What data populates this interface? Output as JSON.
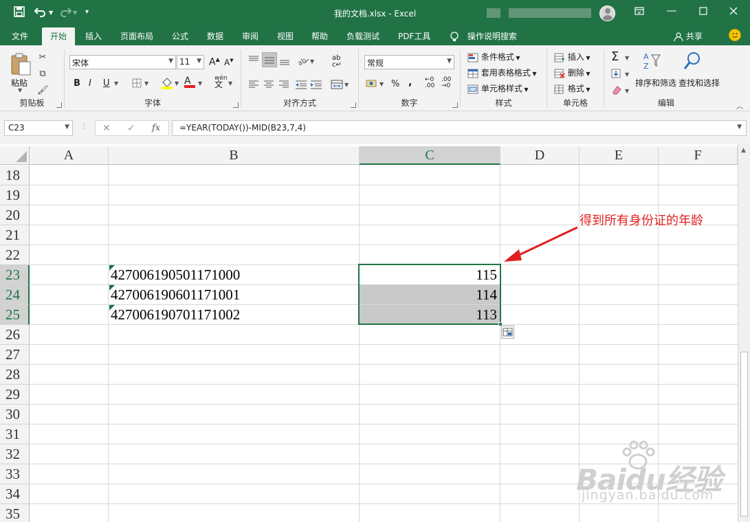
{
  "titlebar": {
    "document_title": "我的文档.xlsx  -  Excel",
    "save_icon": "save-icon",
    "undo_icon": "undo-icon",
    "redo_icon": "redo-icon",
    "customize_icon": "customize-qat-icon",
    "ribbon_display_icon": "ribbon-display-options-icon",
    "minimize_icon": "minimize-icon",
    "maximize_icon": "maximize-icon",
    "close_icon": "close-icon"
  },
  "tabs": [
    {
      "label": "文件"
    },
    {
      "label": "开始"
    },
    {
      "label": "插入"
    },
    {
      "label": "页面布局"
    },
    {
      "label": "公式"
    },
    {
      "label": "数据"
    },
    {
      "label": "审阅"
    },
    {
      "label": "视图"
    },
    {
      "label": "帮助"
    },
    {
      "label": "负载测试"
    },
    {
      "label": "PDF工具"
    }
  ],
  "active_tab": "开始",
  "tell_me": "操作说明搜索",
  "share": "共享",
  "ribbon": {
    "clipboard": {
      "paste": "粘贴",
      "label": "剪贴板"
    },
    "font": {
      "name": "宋体",
      "size": "11",
      "bold": "B",
      "italic": "I",
      "underline": "U",
      "label": "字体"
    },
    "alignment": {
      "label": "对齐方式"
    },
    "number": {
      "format": "常规",
      "label": "数字"
    },
    "styles": {
      "conditional": "条件格式",
      "table": "套用表格格式",
      "cell_styles": "单元格样式",
      "label": "样式"
    },
    "cells": {
      "insert": "插入",
      "delete": "删除",
      "format": "格式",
      "label": "单元格"
    },
    "editing": {
      "sort_filter": "排序和筛选",
      "find_select": "查找和选择",
      "label": "编辑"
    }
  },
  "formula_bar": {
    "name_box": "C23",
    "formula": "=YEAR(TODAY())-MID(B23,7,4)"
  },
  "columns": [
    "A",
    "B",
    "C",
    "D",
    "E",
    "F"
  ],
  "selected_column": "C",
  "rows": [
    "18",
    "19",
    "20",
    "21",
    "22",
    "23",
    "24",
    "25",
    "26",
    "27",
    "28",
    "29",
    "30",
    "31",
    "32",
    "33",
    "34",
    "35"
  ],
  "selected_rows": [
    "23",
    "24",
    "25"
  ],
  "cells": {
    "B23": "427006190501171000",
    "B24": "427006190601171001",
    "B25": "427006190701171002",
    "C23": "115",
    "C24": "114",
    "C25": "113"
  },
  "annotation": "得到所有身份证的年龄",
  "watermark": {
    "logo": "Baidu经验",
    "url": "jingyan.baidu.com"
  },
  "colors": {
    "excel_green": "#217346",
    "annotation_red": "#e02020"
  }
}
